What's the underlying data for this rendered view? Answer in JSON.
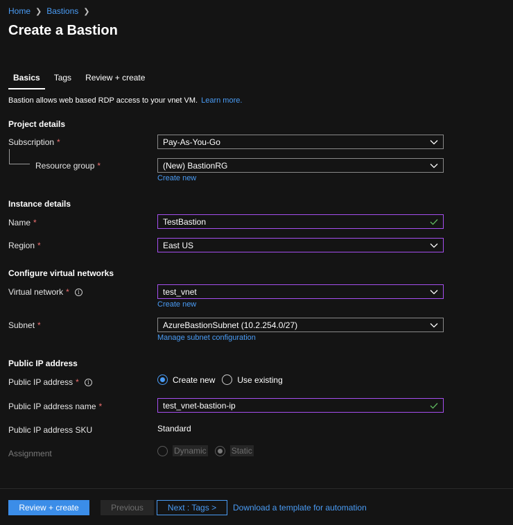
{
  "breadcrumb": {
    "home": "Home",
    "bastions": "Bastions"
  },
  "page_title": "Create a Bastion",
  "tabs": [
    {
      "label": "Basics",
      "active": true
    },
    {
      "label": "Tags",
      "active": false
    },
    {
      "label": "Review + create",
      "active": false
    }
  ],
  "intro": {
    "text": "Bastion allows web based RDP access to your vnet VM.",
    "link": "Learn more."
  },
  "project": {
    "heading": "Project details",
    "subscription_label": "Subscription",
    "subscription_value": "Pay-As-You-Go",
    "resource_group_label": "Resource group",
    "resource_group_value": "(New) BastionRG",
    "create_new": "Create new"
  },
  "instance": {
    "heading": "Instance details",
    "name_label": "Name",
    "name_value": "TestBastion",
    "region_label": "Region",
    "region_value": "East US"
  },
  "network": {
    "heading": "Configure virtual networks",
    "vnet_label": "Virtual network",
    "vnet_value": "test_vnet",
    "create_new": "Create new",
    "subnet_label": "Subnet",
    "subnet_value": "AzureBastionSubnet (10.2.254.0/27)",
    "manage_subnet": "Manage subnet configuration"
  },
  "public_ip": {
    "heading": "Public IP address",
    "ip_label": "Public IP address",
    "option_create_new": "Create new",
    "option_use_existing": "Use existing",
    "selected": "Create new",
    "ip_name_label": "Public IP address name",
    "ip_name_value": "test_vnet-bastion-ip",
    "sku_label": "Public IP address SKU",
    "sku_value": "Standard",
    "assignment_label": "Assignment",
    "option_dynamic": "Dynamic",
    "option_static": "Static",
    "assignment_selected": "Static"
  },
  "required_marker": "*",
  "info_icon": "i",
  "footer": {
    "review_create": "Review + create",
    "previous": "Previous",
    "next": "Next : Tags >",
    "download_template": "Download a template for automation"
  },
  "colors": {
    "accent": "#4a9cf5",
    "valid_border": "#a64ff0",
    "required": "#f07070",
    "background": "#141414"
  },
  "icons": [
    "chevron-down-icon",
    "checkmark-icon",
    "info-icon",
    "chevron-right-icon"
  ]
}
